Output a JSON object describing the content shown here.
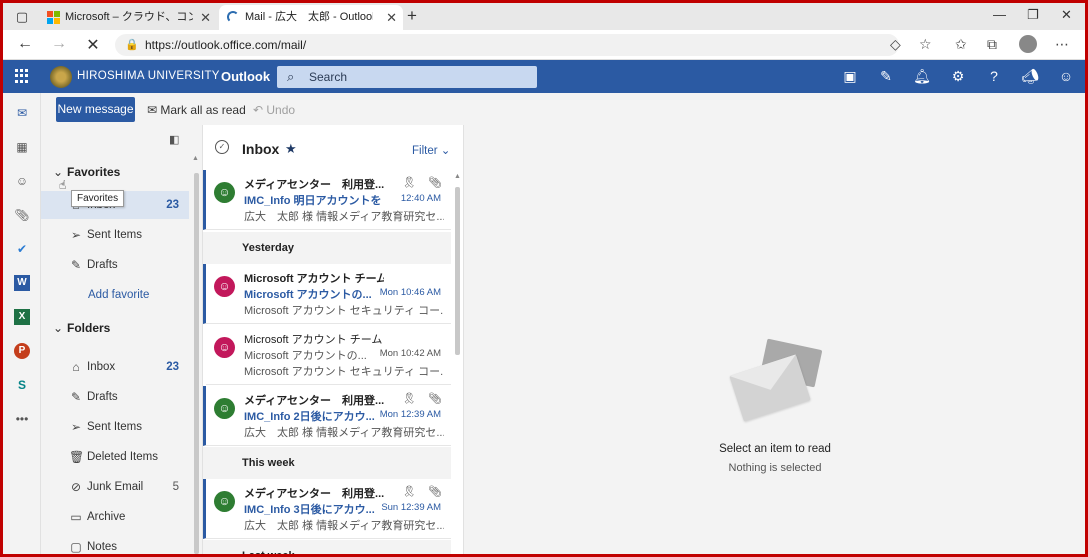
{
  "browser": {
    "tabs": [
      {
        "title": "Microsoft – クラウド、コンピューター、",
        "favicon": "microsoft-logo"
      },
      {
        "title": "Mail - 広大　太郎 - Outlook",
        "favicon": "loading-spinner"
      }
    ],
    "url": "https://outlook.office.com/mail/"
  },
  "header": {
    "org_name": "HIROSHIMA UNIVERSITY",
    "app_name": "Outlook",
    "search_placeholder": "Search",
    "accent": "#2b5aa3"
  },
  "commands": {
    "new_message": "New message",
    "mark_all_read": "Mark all as read",
    "undo": "Undo"
  },
  "folders": {
    "favorites_header": "Favorites",
    "favorites": [
      {
        "label": "Inbox",
        "count": "23",
        "icon": "inbox-icon"
      },
      {
        "label": "Sent Items",
        "count": "",
        "icon": "send-icon"
      },
      {
        "label": "Drafts",
        "count": "",
        "icon": "pencil-icon"
      }
    ],
    "add_favorite": "Add favorite",
    "folders_header": "Folders",
    "items": [
      {
        "label": "Inbox",
        "count": "23",
        "icon": "inbox-icon"
      },
      {
        "label": "Drafts",
        "count": "",
        "icon": "pencil-icon"
      },
      {
        "label": "Sent Items",
        "count": "",
        "icon": "send-icon"
      },
      {
        "label": "Deleted Items",
        "count": "",
        "icon": "trash-icon"
      },
      {
        "label": "Junk Email",
        "count": "5",
        "icon": "block-icon"
      },
      {
        "label": "Archive",
        "count": "",
        "icon": "archive-icon"
      },
      {
        "label": "Notes",
        "count": "",
        "icon": "note-icon"
      }
    ],
    "tooltip": "Favorites"
  },
  "message_list": {
    "title": "Inbox",
    "filter": "Filter",
    "groups": [
      "Yesterday",
      "This week",
      "Last week"
    ],
    "messages": [
      {
        "from": "メディアセンター　利用登...",
        "subject": "IMC_Info 明日アカウントを...",
        "time": "12:40 AM",
        "preview": "広大　太郎 様 情報メディア教育研究セ...",
        "unread": true,
        "avatar_color": "#2e7d32"
      },
      {
        "from": "Microsoft アカウント チーム",
        "subject": "Microsoft アカウントの...",
        "time": "Mon 10:46 AM",
        "preview": "Microsoft アカウント セキュリティ コー...",
        "unread": true,
        "avatar_color": "#c2185b"
      },
      {
        "from": "Microsoft アカウント チーム",
        "subject": "Microsoft アカウントの...",
        "time": "Mon 10:42 AM",
        "preview": "Microsoft アカウント セキュリティ コー...",
        "unread": false,
        "avatar_color": "#c2185b"
      },
      {
        "from": "メディアセンター　利用登...",
        "subject": "IMC_Info 2日後にアカウ...",
        "time": "Mon 12:39 AM",
        "preview": "広大　太郎 様 情報メディア教育研究セ...",
        "unread": true,
        "avatar_color": "#2e7d32"
      },
      {
        "from": "メディアセンター　利用登...",
        "subject": "IMC_Info 3日後にアカウ...",
        "time": "Sun 12:39 AM",
        "preview": "広大　太郎 様 情報メディア教育研究セ...",
        "unread": true,
        "avatar_color": "#2e7d32"
      }
    ]
  },
  "reading_pane": {
    "title": "Select an item to read",
    "subtitle": "Nothing is selected"
  }
}
